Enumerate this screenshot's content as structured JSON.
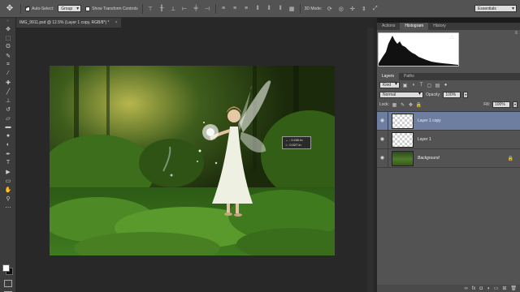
{
  "options_bar": {
    "auto_select_label": "Auto-Select:",
    "auto_select_value": "Group",
    "show_transform_label": "Show Transform Controls",
    "mode_3d_label": "3D Mode:",
    "workspace_value": "Essentials"
  },
  "document": {
    "tab_title": "IMG_9911.psd @ 12.5% (Layer 1 copy, RGB/8*) *",
    "tooltip_line1": "↔ : 0.240 in",
    "tooltip_line2": "↕ : 0.027 in"
  },
  "histogram_panel": {
    "tabs": [
      "Actions",
      "Histogram",
      "History"
    ],
    "active_tab": "Histogram"
  },
  "layers_panel": {
    "tabs": [
      "Layers",
      "Paths"
    ],
    "active_tab": "Layers",
    "filter_kind": "Kind",
    "blend_mode": "Normal",
    "opacity_label": "Opacity:",
    "opacity_value": "100%",
    "lock_label": "Lock:",
    "fill_label": "Fill:",
    "fill_value": "100%",
    "layers": [
      {
        "name": "Layer 1 copy",
        "selected": true
      },
      {
        "name": "Layer 1",
        "selected": false
      },
      {
        "name": "Background",
        "selected": false,
        "locked": true
      }
    ]
  },
  "colors": {
    "ui_bg": "#535353",
    "canvas_bg": "#282828",
    "selection": "#6e7ea0"
  },
  "icons": [
    "move-tool-icon",
    "eye-icon",
    "lock-icon",
    "warning-icon",
    "trash-icon",
    "new-layer-icon"
  ]
}
